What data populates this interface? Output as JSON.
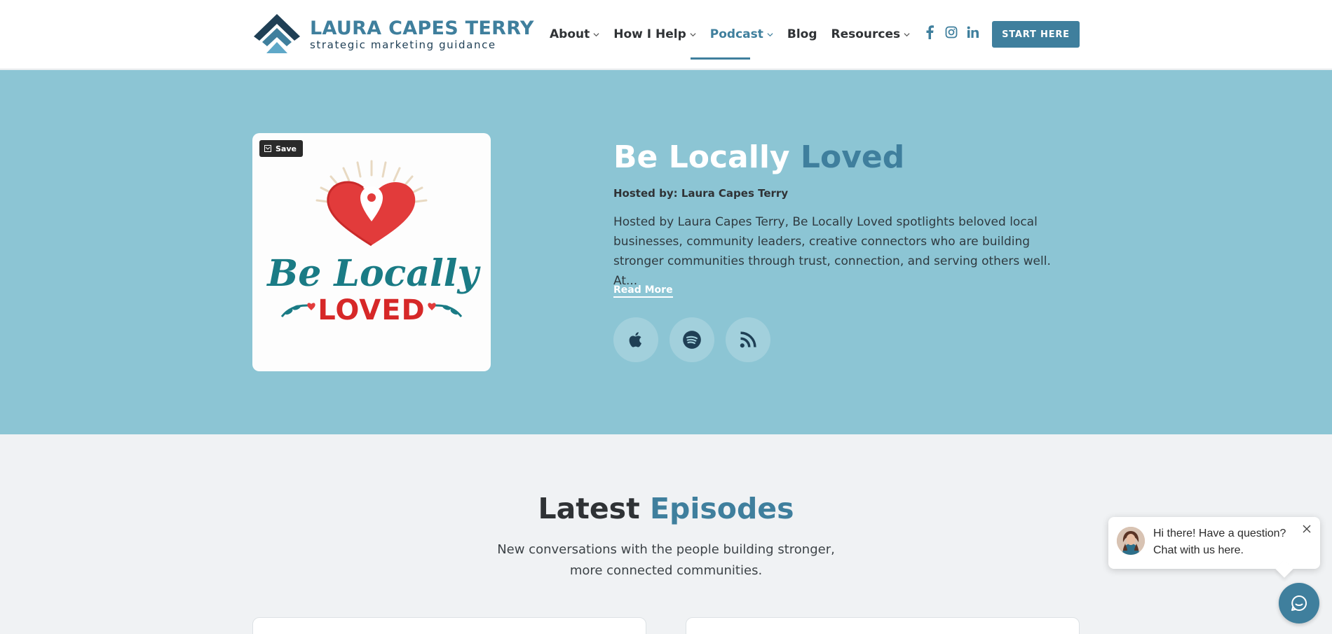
{
  "header": {
    "logo": {
      "title": "LAURA CAPES TERRY",
      "subtitle": "strategic marketing guidance"
    },
    "nav": [
      {
        "label": "About",
        "dropdown": true
      },
      {
        "label": "How I Help",
        "dropdown": true
      },
      {
        "label": "Podcast",
        "dropdown": true,
        "active": true
      },
      {
        "label": "Blog",
        "dropdown": false
      },
      {
        "label": "Resources",
        "dropdown": true
      }
    ],
    "socials": [
      "facebook-icon",
      "instagram-icon",
      "linkedin-icon"
    ],
    "cta_label": "START HERE"
  },
  "hero": {
    "save_label": "Save",
    "cover_art": {
      "line1": "Be Locally",
      "line2": "LOVED"
    },
    "title_main": "Be Locally",
    "title_accent": "Loved",
    "hosted_by": "Hosted by: Laura Capes Terry",
    "description": "Hosted by Laura Capes Terry, Be Locally Loved spotlights beloved local businesses, community leaders, creative connectors who are building stronger communities through trust, connection, and serving others well. At...",
    "read_more": "Read More",
    "platforms": [
      "apple-podcasts-icon",
      "spotify-icon",
      "rss-icon"
    ]
  },
  "latest": {
    "title_main": "Latest",
    "title_accent": "Episodes",
    "subtitle": "New conversations with the people building stronger, more connected communities."
  },
  "chat": {
    "message": "Hi there! Have a question? Chat with us here."
  },
  "colors": {
    "accent": "#3f7f9d",
    "hero_bg": "#8cc5d4",
    "page_bg": "#f0f2f4"
  }
}
